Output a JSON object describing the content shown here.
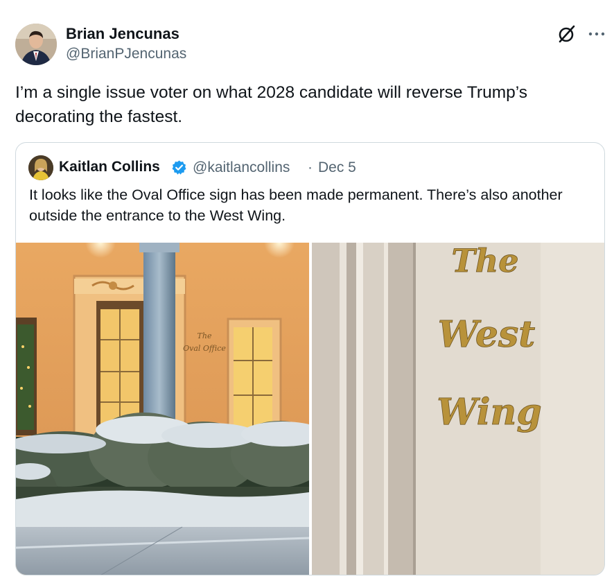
{
  "tweet": {
    "author_name": "Brian Jencunas",
    "author_handle": "@BrianPJencunas",
    "text": "I’m a single issue voter on what 2028 candidate will reverse Trump’s decorating the fastest.",
    "icons": [
      "avatar",
      "grok-icon",
      "more-icon"
    ]
  },
  "quote": {
    "author_name": "Kaitlan Collins",
    "verified": true,
    "handle": "@kaitlancollins",
    "separator": "·",
    "date": "Dec 5",
    "text": "It looks like the Oval Office sign has been made permanent. There’s also another outside the entrance to the West Wing.",
    "media": [
      {
        "sign_line1": "The",
        "sign_line2": "Oval Office"
      },
      {
        "sign_line1": "The",
        "sign_line2": "West",
        "sign_line3": "Wing"
      }
    ]
  },
  "colors": {
    "text_primary": "#0f1419",
    "text_secondary": "#536471",
    "border": "#cfd9de",
    "verified": "#1d9bf0",
    "gold": "#b8923a"
  }
}
